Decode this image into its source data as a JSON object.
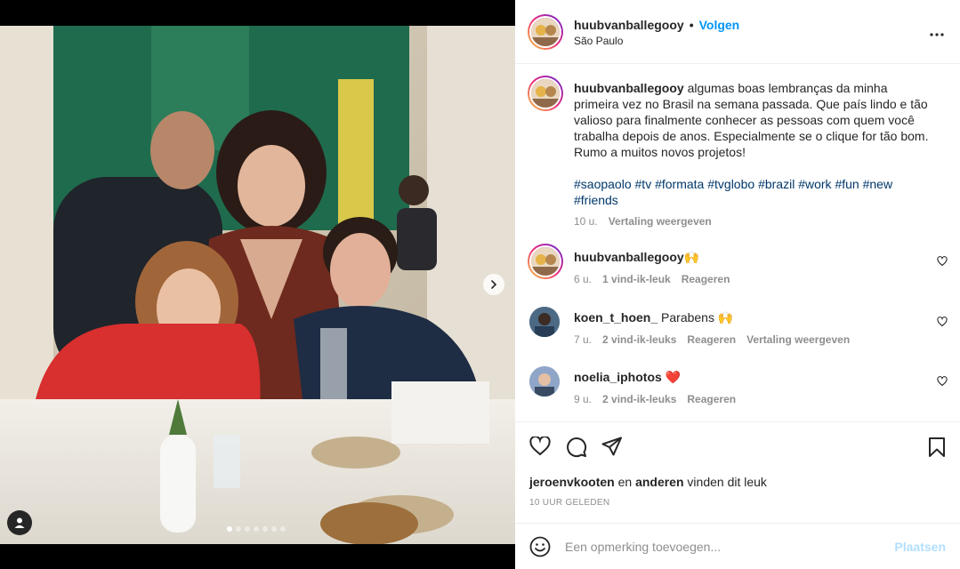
{
  "post": {
    "username": "huubvanballegooy",
    "follow_label": "Volgen",
    "separator": "•",
    "location": "São Paulo"
  },
  "caption": {
    "username": "huubvanballegooy",
    "text": "algumas boas lembranças da minha primeira vez no Brasil na semana passada. Que país lindo e tão valioso para finalmente conhecer as pessoas com quem você trabalha depois de anos. Especialmente se o clique for tão bom. Rumo a muitos novos projetos!",
    "hashtags": [
      "#saopaolo",
      "#tv",
      "#formata",
      "#tvglobo",
      "#brazil",
      "#work",
      "#fun",
      "#new",
      "#friends"
    ],
    "time": "10 u.",
    "translate_label": "Vertaling weergeven"
  },
  "comments": [
    {
      "username": "huubvanballegooy",
      "text": "🙌",
      "time": "6 u.",
      "likes": "1 vind-ik-leuk",
      "reply": "Reageren",
      "translate": ""
    },
    {
      "username": "koen_t_hoen_",
      "text": "Parabens 🙌",
      "time": "7 u.",
      "likes": "2 vind-ik-leuks",
      "reply": "Reageren",
      "translate": "Vertaling weergeven"
    },
    {
      "username": "noelia_iphotos",
      "text": "❤️",
      "time": "9 u.",
      "likes": "2 vind-ik-leuks",
      "reply": "Reageren",
      "translate": ""
    }
  ],
  "likes": {
    "user": "jeroenvkooten",
    "connector": "en",
    "others": "anderen",
    "suffix": "vinden dit leuk"
  },
  "date": "10 UUR GELEDEN",
  "add_comment": {
    "placeholder": "Een opmerking toevoegen...",
    "post_label": "Plaatsen"
  },
  "carousel": {
    "slide_count": 7,
    "active_slide": 1
  },
  "colors": {
    "accent": "#0095f6",
    "hashtag": "#00376b",
    "muted": "#8e8e8e",
    "post_disabled": "#b2dffc"
  },
  "icons": [
    "next-icon",
    "user-tag-icon",
    "more-icon",
    "heart-icon",
    "comment-icon",
    "share-icon",
    "bookmark-icon",
    "emoji-icon"
  ]
}
